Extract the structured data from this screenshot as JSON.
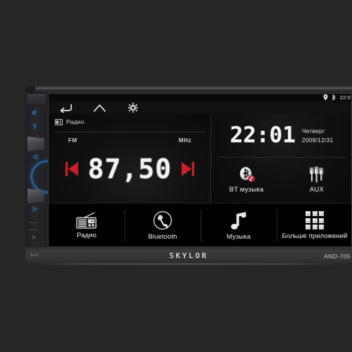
{
  "scene": {
    "background_color": "#262626",
    "subject": "car-stereo-head-unit"
  },
  "device": {
    "brand": "SKYLOR",
    "model": "AND-705",
    "left_connector_label": "AUX",
    "front_panel_glyphs": [
      "↺",
      "T",
      "◁",
      "▷"
    ]
  },
  "screen": {
    "statusbar": {
      "icons": [
        "location-pin-icon",
        "bluetooth-icon"
      ],
      "clock": "22:0"
    },
    "navbar": {
      "buttons": [
        {
          "name": "back",
          "icon": "back-arrow-icon"
        },
        {
          "name": "home",
          "icon": "home-icon"
        },
        {
          "name": "settings",
          "icon": "gear-icon"
        }
      ]
    },
    "radio_panel": {
      "header_icon": "radio-icon",
      "header_label": "Радио",
      "band_label": "FM",
      "unit_label": "MHz",
      "frequency": "87,50",
      "seek_prev_icon": "seek-previous-icon",
      "seek_next_icon": "seek-next-icon",
      "accent_color": "#c8202a"
    },
    "info_panel": {
      "clock": "22:01",
      "day_of_week": "Четверг",
      "date": "2009/12/31",
      "sources": [
        {
          "label": "BT музыка",
          "icon": "bluetooth-music-icon"
        },
        {
          "label": "AUX",
          "icon": "aux-plugs-icon"
        }
      ]
    },
    "app_tiles": [
      {
        "label": "Радио",
        "icon": "radio-icon"
      },
      {
        "label": "Bluetooth",
        "icon": "phone-handset-icon"
      },
      {
        "label": "Музыка",
        "icon": "music-note-icon"
      },
      {
        "label": "Больше приложений",
        "icon": "app-grid-icon"
      }
    ]
  }
}
